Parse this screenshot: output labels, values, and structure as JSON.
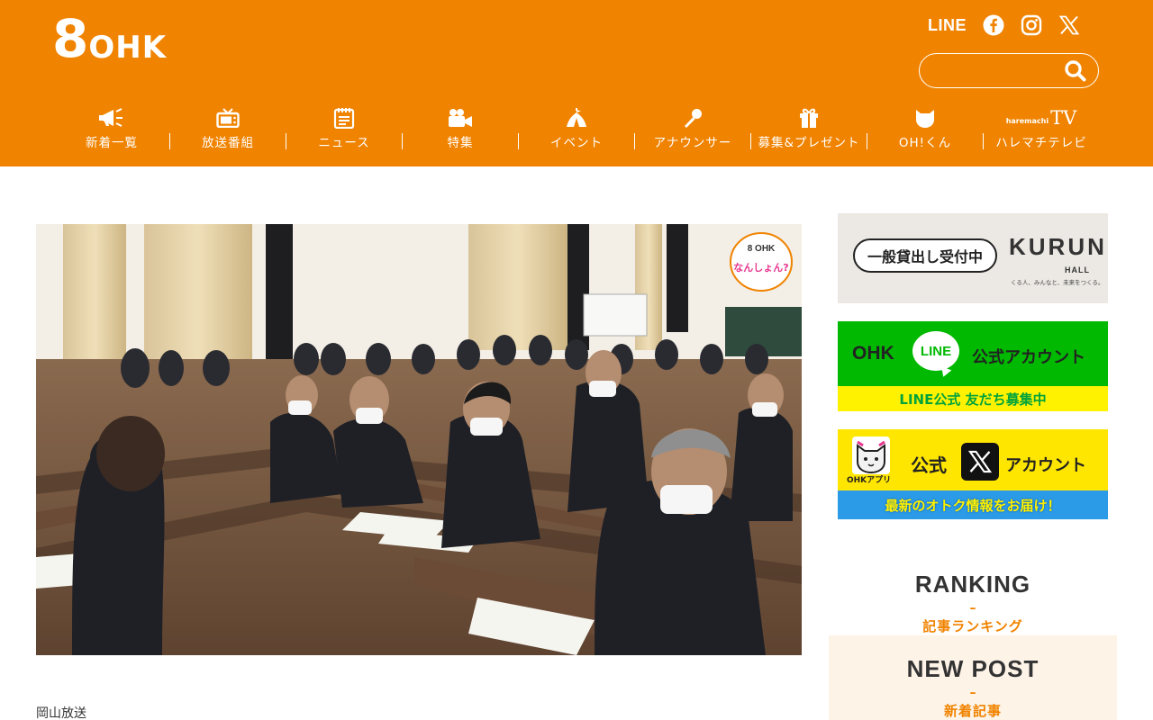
{
  "header": {
    "logo_number": "8",
    "logo_text": "OHK",
    "social": {
      "line_label": "LINE"
    },
    "search": {
      "placeholder": ""
    },
    "nav": [
      {
        "label": "新着一覧",
        "icon": "megaphone-icon"
      },
      {
        "label": "放送番組",
        "icon": "tv-icon"
      },
      {
        "label": "ニュース",
        "icon": "notepad-icon"
      },
      {
        "label": "特集",
        "icon": "video-camera-icon"
      },
      {
        "label": "イベント",
        "icon": "tent-icon"
      },
      {
        "label": "アナウンサー",
        "icon": "microphone-icon"
      },
      {
        "label": "募集&プレゼント",
        "icon": "gift-icon"
      },
      {
        "label": "OH!くん",
        "icon": "mascot-icon"
      },
      {
        "label": "ハレマチテレビ",
        "icon": "haremachi-tv-logo",
        "logo_small": "haremachi",
        "logo_big": "TV"
      }
    ]
  },
  "main": {
    "source": "岡山放送",
    "watermark_top": "8 OHK",
    "watermark_bottom": "なんしょん?"
  },
  "sidebar": {
    "banner_kurun": {
      "pill": "一般貸出し受付中",
      "brand": "KURUN",
      "hall": "HALL",
      "tagline": "くる人、みんなと、未来をつくる。"
    },
    "banner_line": {
      "ohk": "OHK",
      "bubble": "LINE",
      "account": "公式アカウント",
      "strip": "LINE公式 友だち募集中"
    },
    "banner_x": {
      "app": "OHKアプリ",
      "kou": "公式",
      "account": "アカウント",
      "strip": "最新のオトク情報をお届け！"
    },
    "ranking": {
      "title": "RANKING",
      "dash": "–",
      "subtitle": "記事ランキング"
    },
    "new_post": {
      "title": "NEW POST",
      "dash": "–",
      "subtitle": "新着記事"
    }
  },
  "colors": {
    "brand_orange": "#f08300",
    "line_green": "#00b900",
    "x_yellow": "#ffe600",
    "x_blue": "#2b9be8"
  }
}
